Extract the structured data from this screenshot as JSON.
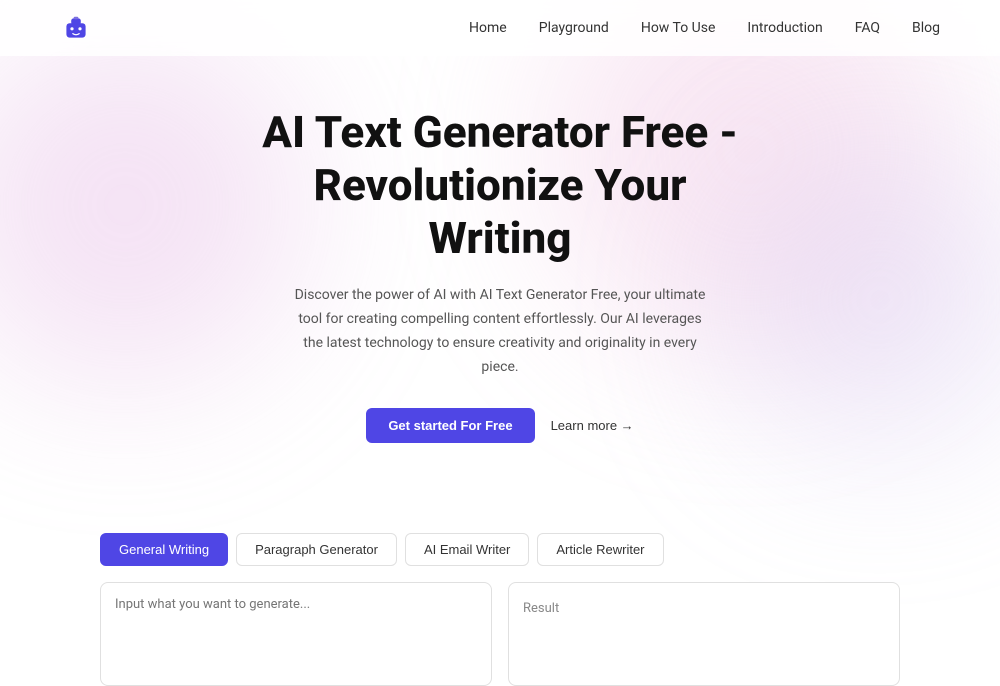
{
  "nav": {
    "links": [
      "Home",
      "Playground",
      "How To Use",
      "Introduction",
      "FAQ",
      "Blog"
    ]
  },
  "hero": {
    "title": "AI Text Generator Free -\nRevolutionize Your\nWriting",
    "subtitle": "Discover the power of AI with AI Text Generator Free, your ultimate tool for creating compelling content effortlessly. Our AI leverages the latest technology to ensure creativity and originality in every piece.",
    "cta_primary": "Get started For Free",
    "cta_secondary": "Learn more →"
  },
  "tabs": [
    {
      "label": "General Writing",
      "active": true
    },
    {
      "label": "Paragraph Generator",
      "active": false
    },
    {
      "label": "AI Email Writer",
      "active": false
    },
    {
      "label": "Article Rewriter",
      "active": false
    }
  ],
  "editor": {
    "input_placeholder": "Input what you want to generate...",
    "result_label": "Result"
  }
}
